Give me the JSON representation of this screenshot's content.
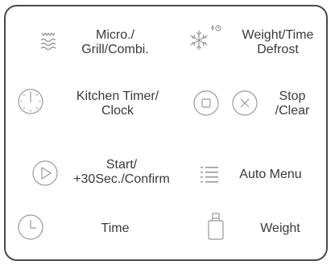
{
  "panel": {
    "buttons": {
      "micro_grill": {
        "line1": "Micro./",
        "line2": "Grill/Combi.",
        "icon": "microwave-waves-icon"
      },
      "weight_defrost": {
        "line1": "Weight/Time",
        "line2": "Defrost",
        "icon": "snowflake-defrost-icon"
      },
      "kitchen_timer": {
        "line1": "Kitchen Timer/",
        "line2": "Clock",
        "icon": "timer-dial-icon"
      },
      "stop_clear": {
        "line1": "Stop",
        "line2": "/Clear",
        "icon_stop": "stop-square-icon",
        "icon_clear": "clear-x-icon"
      },
      "start": {
        "line1": "Start/",
        "line2": "+30Sec./Confirm",
        "icon": "play-triangle-icon"
      },
      "auto_menu": {
        "label": "Auto Menu",
        "icon": "list-menu-icon"
      },
      "time": {
        "label": "Time",
        "icon": "clock-icon"
      },
      "weight": {
        "label": "Weight",
        "icon": "weight-icon"
      }
    }
  },
  "colors": {
    "text": "#3a3a3a",
    "icon": "#9a9a9a",
    "border": "#4a4a4a"
  }
}
